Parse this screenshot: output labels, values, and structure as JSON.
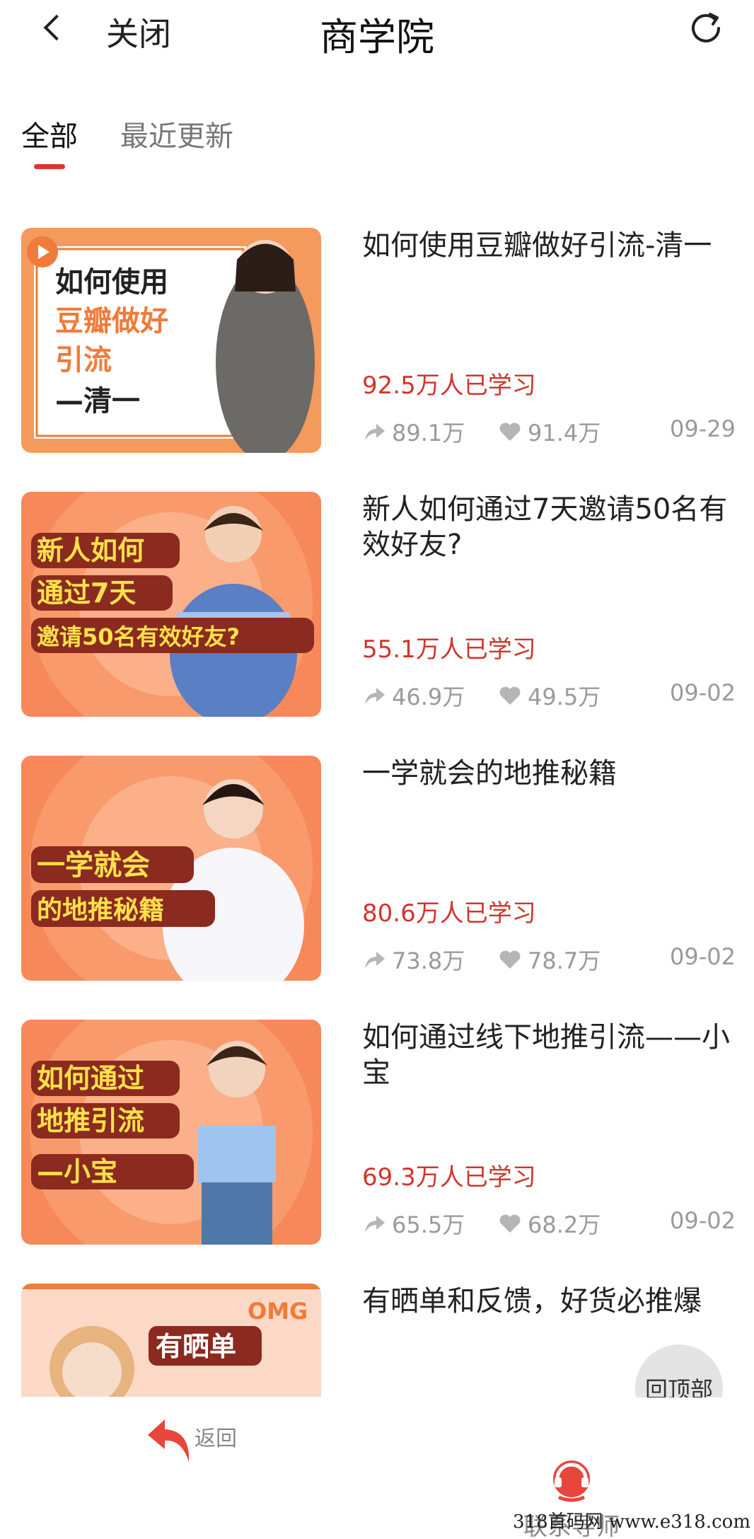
{
  "header": {
    "close_label": "关闭",
    "title": "商学院"
  },
  "tabs": [
    {
      "label": "全部",
      "active": true
    },
    {
      "label": "最近更新",
      "active": false
    }
  ],
  "courses": [
    {
      "title": "如何使用豆瓣做好引流-清一",
      "learners": "92.5万人已学习",
      "shares": "89.1万",
      "likes": "91.4万",
      "date": "09-29",
      "thumb_lines": [
        "如何使用",
        "豆瓣做好",
        "引流",
        "—清一"
      ]
    },
    {
      "title": "新人如何通过7天邀请50名有效好友?",
      "learners": "55.1万人已学习",
      "shares": "46.9万",
      "likes": "49.5万",
      "date": "09-02",
      "thumb_lines": [
        "新人如何",
        "通过7天",
        "邀请50名有效好友?"
      ]
    },
    {
      "title": "一学就会的地推秘籍",
      "learners": "80.6万人已学习",
      "shares": "73.8万",
      "likes": "78.7万",
      "date": "09-02",
      "thumb_lines": [
        "一学就会",
        "的地推秘籍"
      ]
    },
    {
      "title": "如何通过线下地推引流——小宝",
      "learners": "69.3万人已学习",
      "shares": "65.5万",
      "likes": "68.2万",
      "date": "09-02",
      "thumb_lines": [
        "如何通过",
        "地推引流",
        "—小宝"
      ]
    },
    {
      "title": "有晒单和反馈，好货必推爆",
      "thumb_lines": [
        "OMG",
        "有晒单"
      ]
    }
  ],
  "back_to_top_label": "回顶部",
  "bottom_nav": {
    "back_label": "返回",
    "contact_label": "联系导师"
  },
  "watermark": "318首码网  www.e318.com",
  "colors": {
    "accent": "#e0332c",
    "thumb_orange": "#f7885a",
    "learners_red": "#d0352c"
  }
}
